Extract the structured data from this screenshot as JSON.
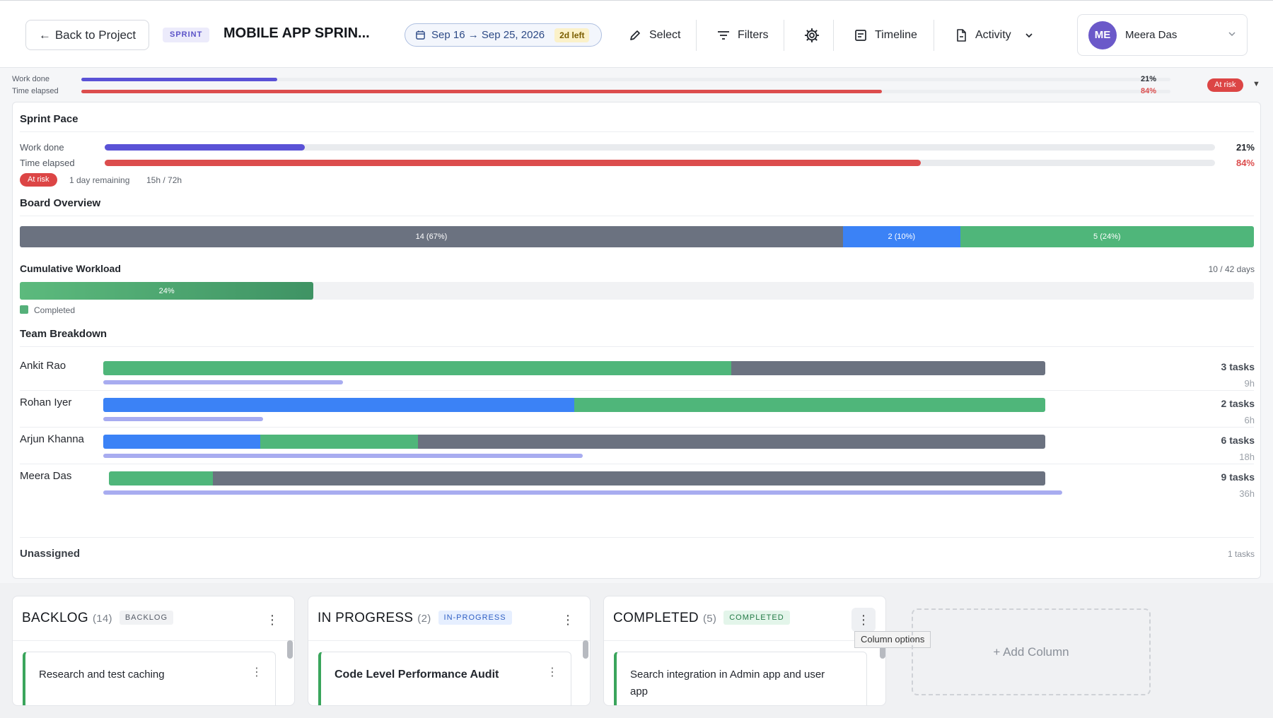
{
  "topbar": {
    "back_label": "Back to Project",
    "sprint_tag": "SPRINT",
    "sprint_title": "MOBILE APP SPRIN...",
    "date_range": "Sep 16 → Sep 25, 2026",
    "days_left": "2d left",
    "select_label": "Select",
    "filters_label": "Filters",
    "timeline_label": "Timeline",
    "activity_label": "Activity",
    "user_initials": "ME",
    "user_name": "Meera Das"
  },
  "mini_progress": {
    "work_label": "Work done",
    "time_label": "Time elapsed",
    "work_pct": "21%",
    "time_pct": "84%",
    "status": "At risk",
    "work_value": 0.18,
    "time_value": 0.735
  },
  "sprint_pace": {
    "title": "Sprint Pace",
    "work_label": "Work done",
    "time_label": "Time elapsed",
    "work_pct": "21%",
    "time_pct": "84%",
    "work_value": 0.18,
    "time_value": 0.735,
    "status": "At risk",
    "remaining": "1 day remaining",
    "hours": "15h / 72h"
  },
  "board_overview": {
    "title": "Board Overview",
    "segments": [
      {
        "label": "14 (67%)",
        "fraction": 0.667,
        "color": "#6b7280"
      },
      {
        "label": "2 (10%)",
        "fraction": 0.095,
        "color": "#3b82f6"
      },
      {
        "label": "5 (24%)",
        "fraction": 0.238,
        "color": "#4fb67a"
      }
    ]
  },
  "cumulative": {
    "title": "Cumulative Workload",
    "days": "10 / 42 days",
    "pct_label": "24%",
    "fraction": 0.238,
    "legend": "Completed"
  },
  "team": {
    "title": "Team Breakdown",
    "members": [
      {
        "name": "Ankit Rao",
        "tasks": "3 tasks",
        "hours": "9h",
        "hours_fraction": 0.25,
        "segments": [
          {
            "fraction": 0.667,
            "color": "#4fb67a"
          },
          {
            "fraction": 0.333,
            "color": "#6b7280"
          }
        ]
      },
      {
        "name": "Rohan Iyer",
        "tasks": "2 tasks",
        "hours": "6h",
        "hours_fraction": 0.167,
        "segments": [
          {
            "fraction": 0.5,
            "color": "#3b82f6"
          },
          {
            "fraction": 0.5,
            "color": "#4fb67a"
          }
        ]
      },
      {
        "name": "Arjun Khanna",
        "tasks": "6 tasks",
        "hours": "18h",
        "hours_fraction": 0.5,
        "segments": [
          {
            "fraction": 0.167,
            "color": "#3b82f6"
          },
          {
            "fraction": 0.167,
            "color": "#4fb67a"
          },
          {
            "fraction": 0.666,
            "color": "#6b7280"
          }
        ]
      },
      {
        "name": "Meera Das",
        "tasks": "9 tasks",
        "hours": "36h",
        "hours_fraction": 1.0,
        "segments": [
          {
            "fraction": 0.111,
            "color": "#4fb67a"
          },
          {
            "fraction": 0.889,
            "color": "#6b7280"
          }
        ]
      }
    ],
    "unassigned_label": "Unassigned",
    "unassigned_tasks": "1 tasks"
  },
  "columns": [
    {
      "title": "BACKLOG",
      "count": "(14)",
      "tag": "BACKLOG",
      "tag_bg": "#f1f2f4",
      "tag_fg": "#555b66",
      "card_title": "Research and test caching"
    },
    {
      "title": "IN PROGRESS",
      "count": "(2)",
      "tag": "IN-PROGRESS",
      "tag_bg": "#e6efff",
      "tag_fg": "#2f5fc4",
      "card_title": "Code Level Performance Audit"
    },
    {
      "title": "COMPLETED",
      "count": "(5)",
      "tag": "COMPLETED",
      "tag_bg": "#e3f5ea",
      "tag_fg": "#237a46",
      "card_title": "Search integration in Admin app and user app"
    }
  ],
  "tooltip": "Column options",
  "add_column": "+ Add Column"
}
